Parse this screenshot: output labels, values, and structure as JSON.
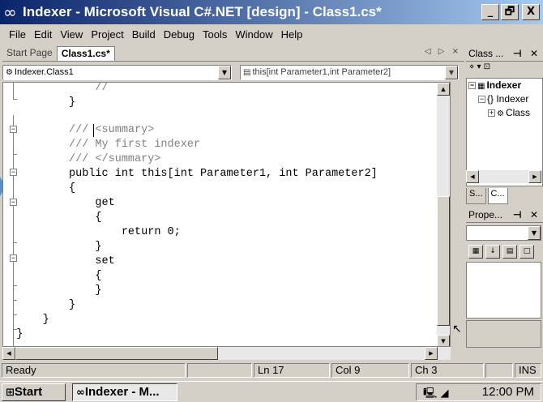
{
  "window": {
    "title": "Indexer - Microsoft Visual C#.NET [design] - Class1.cs*",
    "controls": {
      "minimize": "_",
      "maximize": "🗗",
      "close": "X"
    }
  },
  "menubar": {
    "items": [
      "File",
      "Edit",
      "View",
      "Project",
      "Build",
      "Debug",
      "Tools",
      "Window",
      "Help"
    ]
  },
  "doc_tabs": {
    "tabs": [
      {
        "label": "Start Page",
        "active": false
      },
      {
        "label": "Class1.cs*",
        "active": true
      }
    ],
    "controls": "◁ ▷ ×"
  },
  "navigation": {
    "types_combo": "Indexer.Class1",
    "members_combo": "this[int Parameter1,int Parameter2]"
  },
  "code_lines": [
    "              //",
    "          }",
    "",
    "          /// <summary>",
    "          /// My first indexer",
    "          /// </summary>",
    "          public int this[int Parameter1, int Parameter2]",
    "          {",
    "              get",
    "              {",
    "                  return 0;",
    "              }",
    "              set",
    "              {",
    "              }",
    "          }",
    "      }",
    "  }"
  ],
  "class_view": {
    "title": "Class ...",
    "pin": "⊣ ✕",
    "toolbar": "⋄ ▾  ⊡",
    "tree": [
      {
        "label": "Indexer",
        "bold": true
      },
      {
        "label": "{} Indexer",
        "bold": false
      },
      {
        "label": "Class",
        "bold": false
      }
    ],
    "tabs": [
      "S...",
      "C..."
    ]
  },
  "properties": {
    "title": "Prope...",
    "pin": "⊣ ✕"
  },
  "statusbar": {
    "text": "Ready",
    "line": "Ln 17",
    "col": "Col 9",
    "ch": "Ch 3",
    "mode": "INS"
  },
  "taskbar": {
    "start_label": "Start",
    "task_label": "Indexer - M...",
    "clock": "12:00 PM"
  }
}
